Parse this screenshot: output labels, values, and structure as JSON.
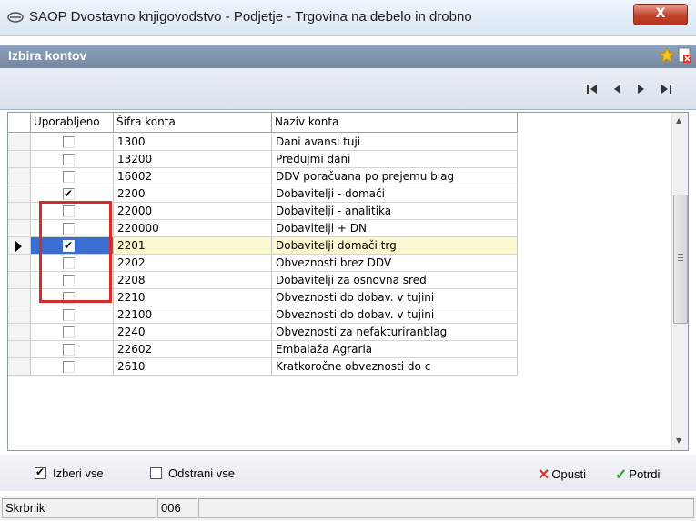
{
  "window": {
    "title": "SAOP Dvostavno knjigovodstvo  - Podjetje - Trgovina na debelo in drobno",
    "close_label": "X"
  },
  "dialog": {
    "title": "Izbira kontov"
  },
  "grid": {
    "columns": [
      "Uporabljeno",
      "Šifra konta",
      "Naziv konta"
    ],
    "rows": [
      {
        "checked": false,
        "code": "1300",
        "name": "Dani avansi tuji"
      },
      {
        "checked": false,
        "code": "13200",
        "name": "Predujmi dani"
      },
      {
        "checked": false,
        "code": "16002",
        "name": "DDV poračuana po prejemu  blag"
      },
      {
        "checked": true,
        "code": "2200",
        "name": "Dobavitelji - domači"
      },
      {
        "checked": false,
        "code": "22000",
        "name": "Dobavitelji - analitika"
      },
      {
        "checked": false,
        "code": "220000",
        "name": "Dobavitelji + DN"
      },
      {
        "checked": true,
        "code": "2201",
        "name": "Dobavitelji domači trg",
        "current": true
      },
      {
        "checked": false,
        "code": "2202",
        "name": "Obveznosti brez DDV"
      },
      {
        "checked": false,
        "code": "2208",
        "name": "Dobavitelji za osnovna    sred"
      },
      {
        "checked": false,
        "code": "2210",
        "name": "Obveznosti do dobav. v tujini"
      },
      {
        "checked": false,
        "code": "22100",
        "name": "Obveznosti do dobav. v tujini"
      },
      {
        "checked": false,
        "code": "2240",
        "name": "Obveznosti za nefakturiranblag"
      },
      {
        "checked": false,
        "code": "22602",
        "name": "Embalaža Agraria"
      },
      {
        "checked": false,
        "code": "2610",
        "name": "Kratkoročne obveznosti    do c"
      }
    ]
  },
  "options": {
    "select_all_label": "Izberi vse",
    "select_all_checked": true,
    "remove_all_label": "Odstrani vse",
    "remove_all_checked": false
  },
  "actions": {
    "cancel_label": "Opusti",
    "confirm_label": "Potrdi"
  },
  "status": {
    "field_label": "Skrbnik",
    "field_value": "006"
  },
  "colors": {
    "header_bar": "#74899f",
    "selection": "#3a6fd0",
    "current_row": "#fbf7cf",
    "highlight_box": "#d42b2b"
  }
}
